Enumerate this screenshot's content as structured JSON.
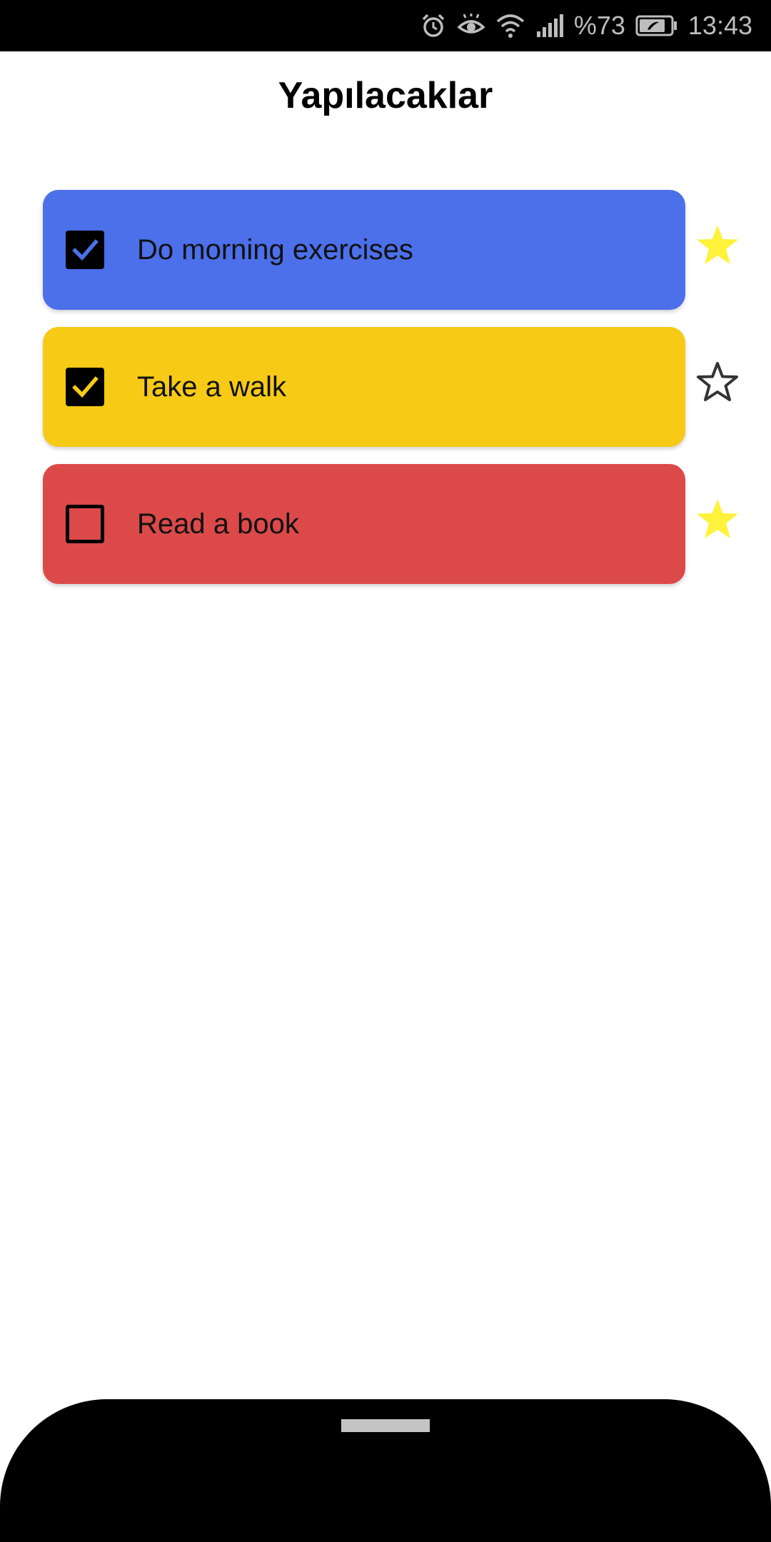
{
  "status_bar": {
    "battery": "%73",
    "time": "13:43",
    "icons": [
      "alarm-icon",
      "eye-comfort-icon",
      "wifi-icon",
      "signal-icon",
      "battery-icon"
    ]
  },
  "header": {
    "title": "Yapılacaklar"
  },
  "tasks": [
    {
      "label": "Do morning exercises",
      "checked": true,
      "starred": true,
      "color": "#4C6FEA",
      "check_color": "#4C6FEA"
    },
    {
      "label": "Take a walk",
      "checked": true,
      "starred": false,
      "color": "#F7CA15",
      "check_color": "#F7CA15"
    },
    {
      "label": "Read a book",
      "checked": false,
      "starred": true,
      "color": "#DC4949",
      "check_color": "#000000"
    }
  ],
  "colors": {
    "star_filled": "#FFF23A",
    "star_outline": "#333333"
  }
}
